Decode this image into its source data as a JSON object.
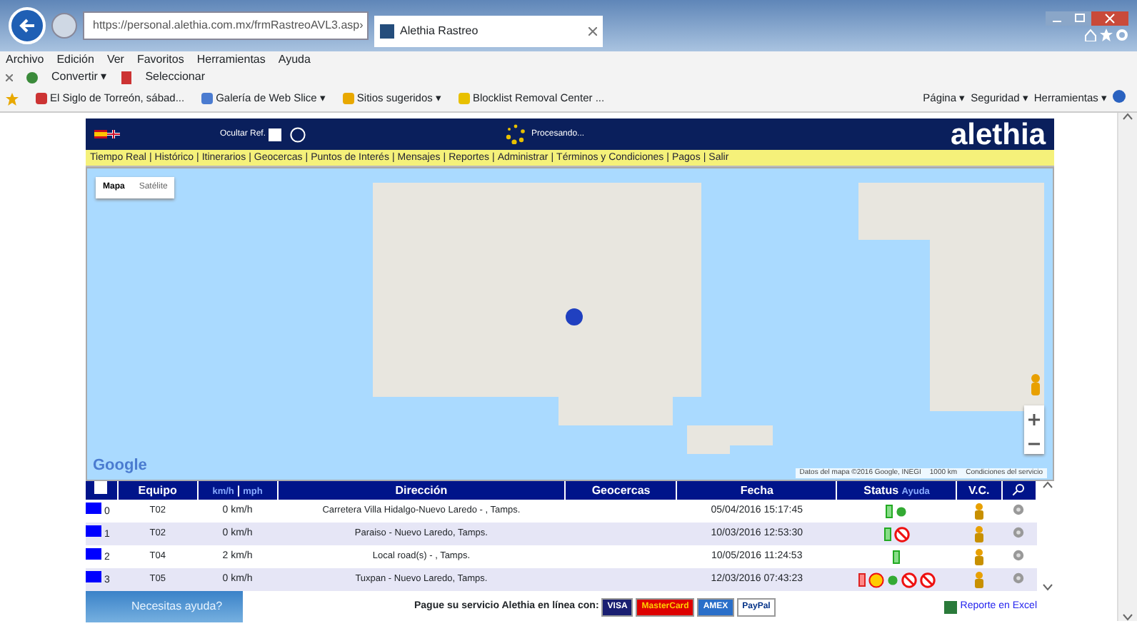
{
  "browser": {
    "address": "https://personal.alethia.com.mx/frmRastreoAVL3.asp›",
    "tab_title": "Alethia Rastreo",
    "menu": [
      "Archivo",
      "Edición",
      "Ver",
      "Favoritos",
      "Herramientas",
      "Ayuda"
    ],
    "toolbar": [
      "Convertir ▾",
      "Seleccionar"
    ],
    "favorites": [
      "El Siglo de Torreón, sábad...",
      "Galería de Web Slice ▾",
      "Sitios sugeridos ▾",
      "Blocklist Removal Center ..."
    ],
    "commands": [
      "Página ▾",
      "Seguridad ▾",
      "Herramientas ▾"
    ]
  },
  "header": {
    "hide_label": "Ocultar Ref.",
    "hide_checked": false,
    "status": "Procesando...",
    "logo": "alethia"
  },
  "nav_separator": "|",
  "nav": [
    "Tiempo Real",
    "Histórico",
    "Itinerarios",
    "Geocercas",
    "Puntos de Interés",
    "Mensajes",
    "Reportes",
    "Administrar",
    "Términos y Condiciones",
    "Pagos",
    "Salir"
  ],
  "map": {
    "types": [
      {
        "label": "Mapa",
        "selected": true
      },
      {
        "label": "Satélite",
        "selected": false
      }
    ],
    "brand": "Google",
    "attribution": "Datos del mapa ©2016 Google, INEGI",
    "scale": "1000 km",
    "terms": "Condiciones del servicio"
  },
  "table": {
    "columns": [
      "Equipo",
      "Dirección",
      "Geocercas",
      "Fecha",
      "Status",
      "V.C."
    ],
    "units": [
      "km/h",
      "mph"
    ],
    "unit_separator": "|",
    "select_all_checked": false,
    "status_help": "Ayuda",
    "rows": [
      {
        "index": "0",
        "equipo": "T02",
        "speed": "0 km/h",
        "direccion": "Carretera Villa Hidalgo-Nuevo Laredo - , Tamps.",
        "fecha": "05/04/2016 15:17:45",
        "status": [
          {
            "kind": "battery-ok"
          },
          {
            "kind": "engine"
          }
        ]
      },
      {
        "index": "1",
        "equipo": "T02",
        "speed": "0 km/h",
        "direccion": "Paraiso - Nuevo Laredo, Tamps.",
        "fecha": "10/03/2016 12:53:30",
        "status": [
          {
            "kind": "battery-ok"
          },
          {
            "kind": "prohibited"
          }
        ]
      },
      {
        "index": "2",
        "equipo": "T04",
        "speed": "2 km/h",
        "direccion": "Local road(s) - , Tamps.",
        "fecha": "10/05/2016 11:24:53",
        "status": [
          {
            "kind": "battery-ok"
          }
        ]
      },
      {
        "index": "3",
        "equipo": "T05",
        "speed": "0 km/h",
        "direccion": "Tuxpan - Nuevo Laredo, Tamps.",
        "fecha": "12/03/2016 07:43:23",
        "status": [
          {
            "kind": "battery-low"
          },
          {
            "kind": "warning"
          },
          {
            "kind": "engine"
          },
          {
            "kind": "prohibited"
          },
          {
            "kind": "prohibited"
          }
        ]
      }
    ]
  },
  "footer": {
    "help": "Necesitas ayuda?",
    "pay": "Pague su servicio Alethia en línea con:",
    "cards": [
      "VISA",
      "MasterCard",
      "AMEX",
      "PayPal"
    ],
    "excel": "Reporte en Excel"
  }
}
